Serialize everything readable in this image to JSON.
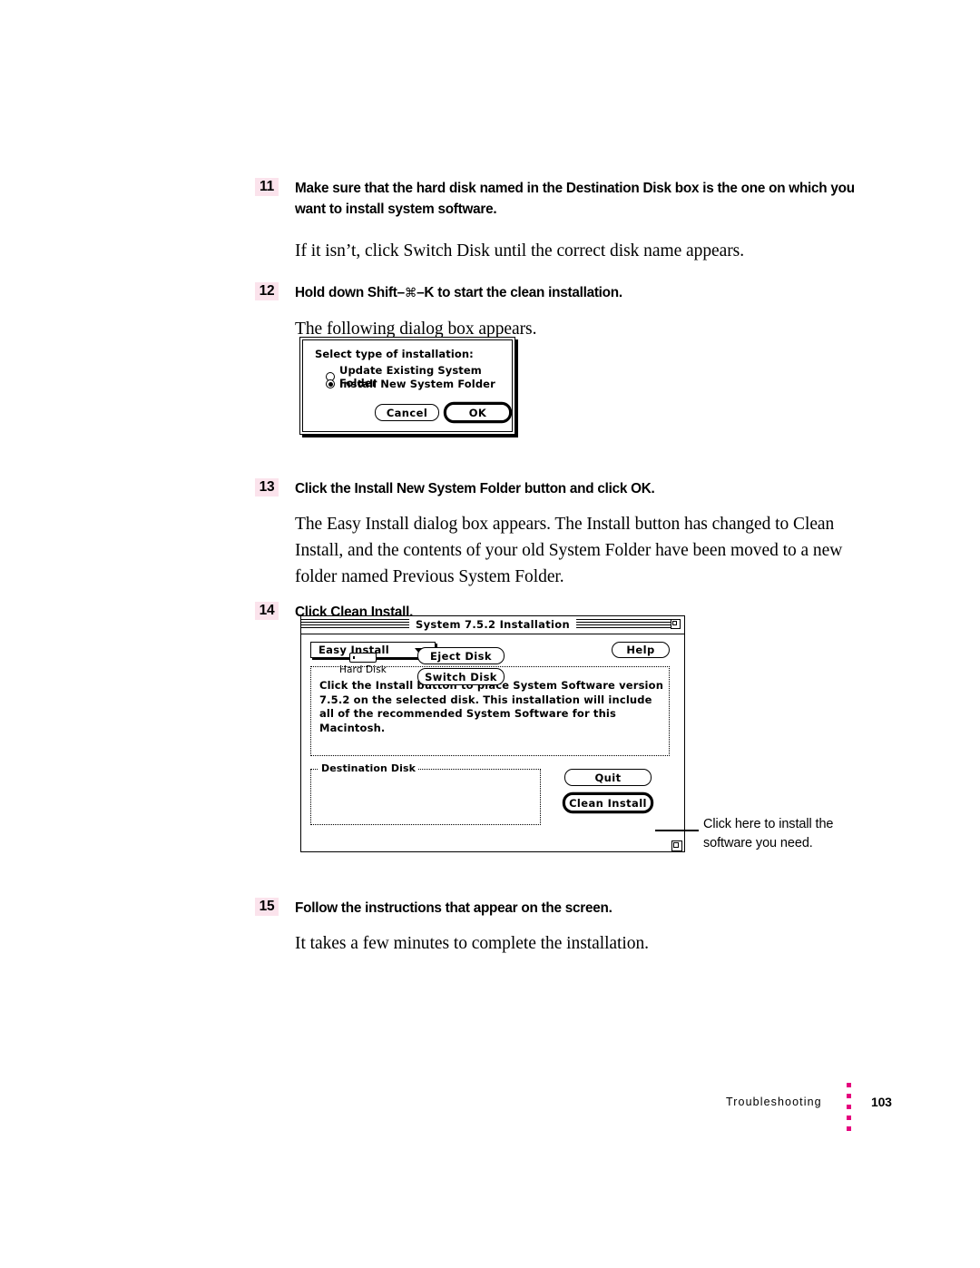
{
  "page": {
    "footer": {
      "chapter": "Troubleshooting",
      "page_number": "103",
      "dot_color": "#e5007e",
      "dot_count": 5
    },
    "step_number_highlight": "#fbe3ec"
  },
  "steps": [
    {
      "number": "11",
      "heading": "Make sure that the hard disk named in the Destination Disk box is the one on which you want to install system software.",
      "body": "If it isn’t, click Switch Disk until the correct disk name appears."
    },
    {
      "number": "12",
      "heading_before_glyph": "Hold down Shift–",
      "heading_glyph": "⌘",
      "heading_after_glyph": "–K to start the clean installation.",
      "body": "The following dialog box appears."
    },
    {
      "number": "13",
      "heading": "Click the Install New System Folder button and click OK.",
      "body": "The Easy Install dialog box appears. The Install button has changed to Clean Install, and the contents of your old System Folder have been moved to a new folder named Previous System Folder."
    },
    {
      "number": "14",
      "heading": "Click Clean Install.",
      "body": ""
    },
    {
      "number": "15",
      "heading": "Follow the instructions that appear on the screen.",
      "body": "It takes a few minutes to complete the installation."
    }
  ],
  "dialog_select": {
    "title": "Select type of installation:",
    "options": [
      {
        "label": "Update Existing System Folder",
        "selected": false
      },
      {
        "label": "Install New System Folder",
        "selected": true
      }
    ],
    "cancel_label": "Cancel",
    "ok_label": "OK"
  },
  "installer_window": {
    "title": "System 7.5.2 Installation",
    "popup_label": "Easy Install",
    "help_label": "Help",
    "message": "Click the Install button to place System Software version 7.5.2 on the selected disk. This installation will include all of the recommended System Software for this Macintosh.",
    "destination_group_label": "Destination Disk",
    "disk_name": "Hard Disk",
    "eject_disk_label": "Eject Disk",
    "switch_disk_label": "Switch Disk",
    "quit_label": "Quit",
    "clean_install_label": "Clean Install"
  },
  "callout": {
    "text": "Click here to install the software you need."
  }
}
